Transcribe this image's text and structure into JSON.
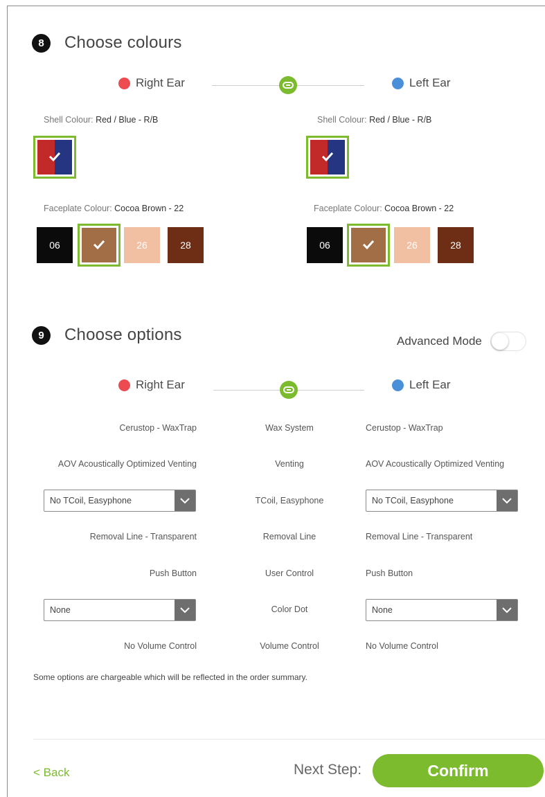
{
  "colours": {
    "step_number": "8",
    "title": "Choose colours",
    "right_ear_label": "Right Ear",
    "left_ear_label": "Left Ear",
    "shell_label": "Shell Colour:",
    "shell_value": "Red / Blue - R/B",
    "faceplate_label": "Faceplate Colour:",
    "faceplate_value": "Cocoa Brown - 22",
    "faceplate_swatches": [
      {
        "code": "06",
        "color": "#0b0b0b"
      },
      {
        "code": "",
        "color": "#a26e45",
        "selected": true
      },
      {
        "code": "26",
        "color": "#f1bfa1"
      },
      {
        "code": "28",
        "color": "#6e2e16"
      }
    ],
    "shell_colors": {
      "red": "#c22a2a",
      "blue": "#253582"
    }
  },
  "options": {
    "step_number": "9",
    "title": "Choose options",
    "advanced_mode_label": "Advanced Mode",
    "advanced_mode_on": false,
    "right_ear_label": "Right Ear",
    "left_ear_label": "Left Ear",
    "rows": [
      {
        "right": "Cerustop - WaxTrap",
        "middle": "Wax System",
        "left": "Cerustop - WaxTrap"
      },
      {
        "right": "AOV Acoustically Optimized Venting",
        "middle": "Venting",
        "left": "AOV Acoustically Optimized Venting"
      },
      {
        "right": "No TCoil, Easyphone",
        "middle": "TCoil, Easyphone",
        "left": "No TCoil, Easyphone"
      },
      {
        "right": "Removal Line - Transparent",
        "middle": "Removal Line",
        "left": "Removal Line - Transparent"
      },
      {
        "right": "Push Button",
        "middle": "User Control",
        "left": "Push Button"
      },
      {
        "right": "None",
        "middle": "Color Dot",
        "left": "None"
      },
      {
        "right": "No Volume Control",
        "middle": "Volume Control",
        "left": "No Volume Control"
      }
    ],
    "note": "Some options are chargeable which will be reflected in the order summary."
  },
  "footer": {
    "back_label": "< Back",
    "next_label": "Next Step:",
    "confirm_label": "Confirm"
  },
  "accent_color": "#7cbb2e",
  "icons": [
    "link-icon",
    "check-icon",
    "chevron-down-icon"
  ]
}
